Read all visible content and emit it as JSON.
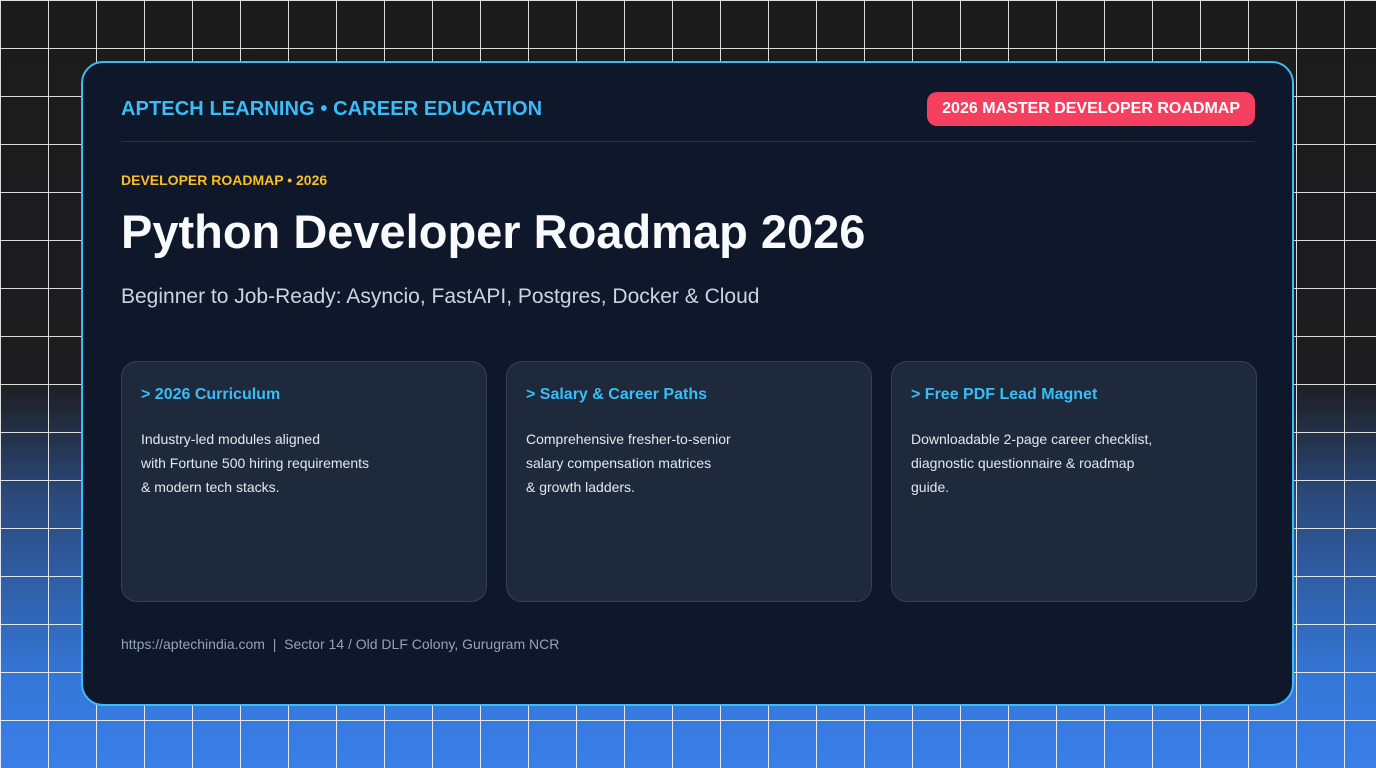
{
  "header": {
    "brand": "APTECH LEARNING • CAREER EDUCATION",
    "badge": "2026 MASTER DEVELOPER ROADMAP"
  },
  "hero": {
    "eyebrow": "DEVELOPER ROADMAP • 2026",
    "title": "Python Developer Roadmap 2026",
    "subtitle": "Beginner to Job-Ready: Asyncio, FastAPI, Postgres, Docker & Cloud"
  },
  "features": [
    {
      "title": "> 2026 Curriculum",
      "lines": [
        "Industry-led modules aligned",
        "with Fortune 500 hiring requirements",
        "& modern tech stacks."
      ]
    },
    {
      "title": "> Salary & Career Paths",
      "lines": [
        "Comprehensive fresher-to-senior",
        "salary compensation matrices",
        "& growth ladders."
      ]
    },
    {
      "title": "> Free PDF Lead Magnet",
      "lines": [
        "Downloadable 2-page career checklist,",
        "diagnostic questionnaire & roadmap",
        "guide."
      ]
    }
  ],
  "footer": {
    "text": "https://aptechindia.com  |  Sector 14 / Old DLF Colony, Gurugram NCR"
  },
  "colors": {
    "accent": "#38bdf8",
    "badge": "#f43f5e",
    "eyebrow": "#fbbf24",
    "card_bg": "#0f172a"
  }
}
